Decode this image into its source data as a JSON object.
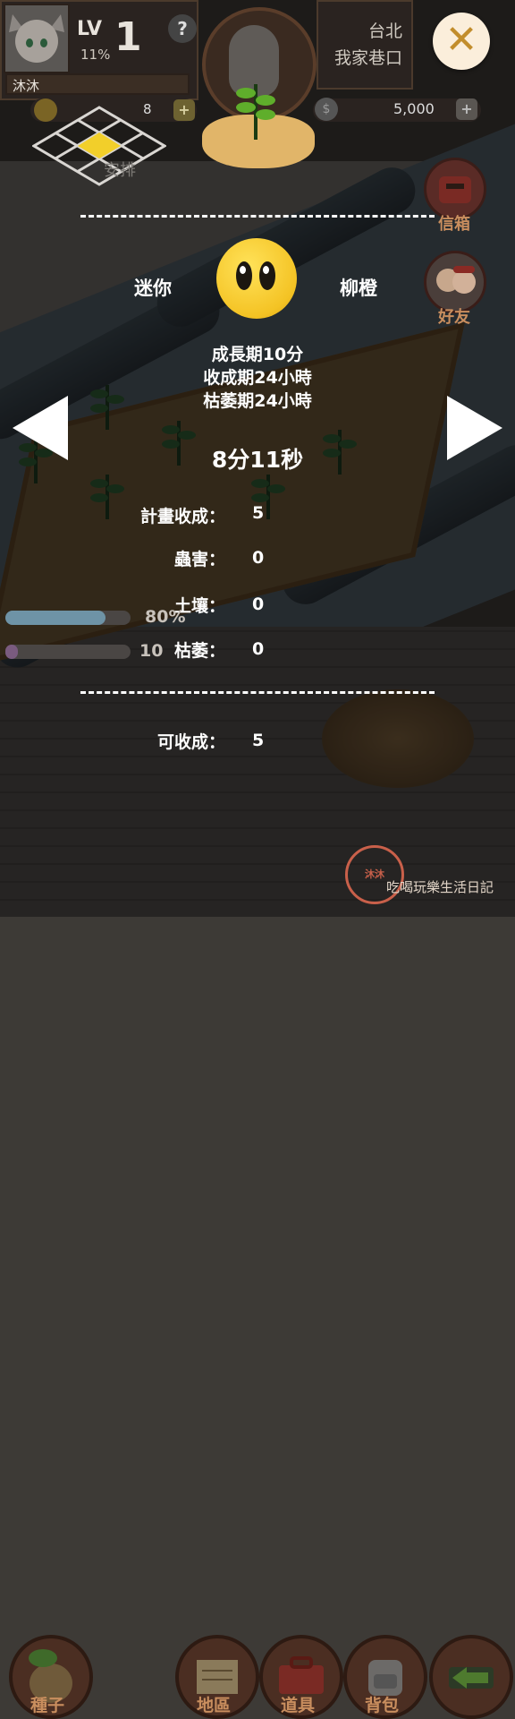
{
  "header": {
    "level_label": "LV",
    "level_value": "1",
    "level_progress": "11%",
    "player_name": "沐沐",
    "help_label": "?",
    "coins": "8",
    "coin_plus": "+",
    "location_city": "台北",
    "location_place": "我家巷口",
    "money": "5,000",
    "money_plus": "+",
    "close_label": "✕"
  },
  "minimap": {
    "label": "安排"
  },
  "side_menu": {
    "mailbox_label": "信箱",
    "friends_label": "好友"
  },
  "seed_panel": {
    "prev_seed": "迷你",
    "next_seed": "柳橙",
    "growth_period": "成長期10分",
    "harvest_period": "收成期24小時",
    "wither_period": "枯萎期24小時",
    "countdown": "8分11秒",
    "stats": [
      {
        "label": "計畫收成：",
        "value": "5"
      },
      {
        "label": "蟲害：",
        "value": "0"
      },
      {
        "label": "土壤：",
        "value": "0"
      },
      {
        "label": "枯萎：",
        "value": "0"
      }
    ],
    "harvestable_label": "可收成：",
    "harvestable_value": "5"
  },
  "status_bars": {
    "water_percent": "80%",
    "water_level": 0.8,
    "fertilizer_percent": "10",
    "fertilizer_level": 0.1
  },
  "bottom_nav": {
    "items": [
      {
        "label": "種子",
        "icon": "seed-bag-icon"
      },
      {
        "label": "地區",
        "icon": "map-scroll-icon"
      },
      {
        "label": "道具",
        "icon": "toolbox-icon"
      },
      {
        "label": "背包",
        "icon": "backpack-icon"
      },
      {
        "label": "",
        "icon": "back-arrow-icon"
      }
    ]
  },
  "watermark": {
    "seal": "沐沐",
    "text": "吃喝玩樂生活日記"
  },
  "colors": {
    "overlay": "#000000",
    "coin_accent": "#d2a62f",
    "close_button": "#fbeedb",
    "close_x": "#c28d2c",
    "seed_yellow": "#f4c324",
    "water_bar": "#6e93a6",
    "fertilizer_bar": "#7a5b7f"
  }
}
